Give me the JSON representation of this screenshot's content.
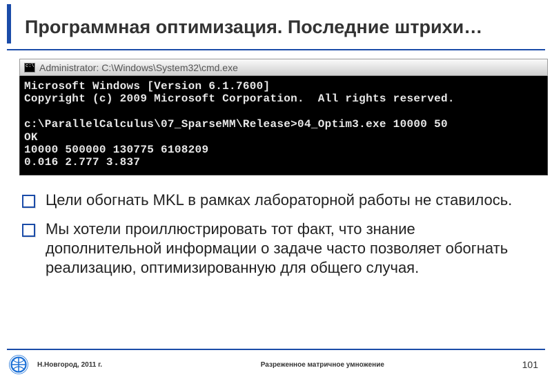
{
  "title": "Программная оптимизация. Последние штрихи…",
  "console": {
    "title": "Administrator: C:\\Windows\\System32\\cmd.exe",
    "lines": [
      "Microsoft Windows [Version 6.1.7600]",
      "Copyright (c) 2009 Microsoft Corporation.  All rights reserved.",
      "",
      "c:\\ParallelCalculus\\07_SparseMM\\Release>04_Optim3.exe 10000 50",
      "OK",
      "10000 500000 130775 6108209",
      "0.016 2.777 3.837"
    ]
  },
  "bullets": [
    "Цели обогнать MKL в рамках лабораторной работы не ставилось.",
    "Мы хотели проиллюстрировать тот факт, что знание дополнительной информации о задаче часто позволяет обогнать реализацию, оптимизированную для общего случая."
  ],
  "footer": {
    "location": "Н.Новгород, 2011 г.",
    "subject": "Разреженное матричное умножение",
    "page": "101"
  }
}
